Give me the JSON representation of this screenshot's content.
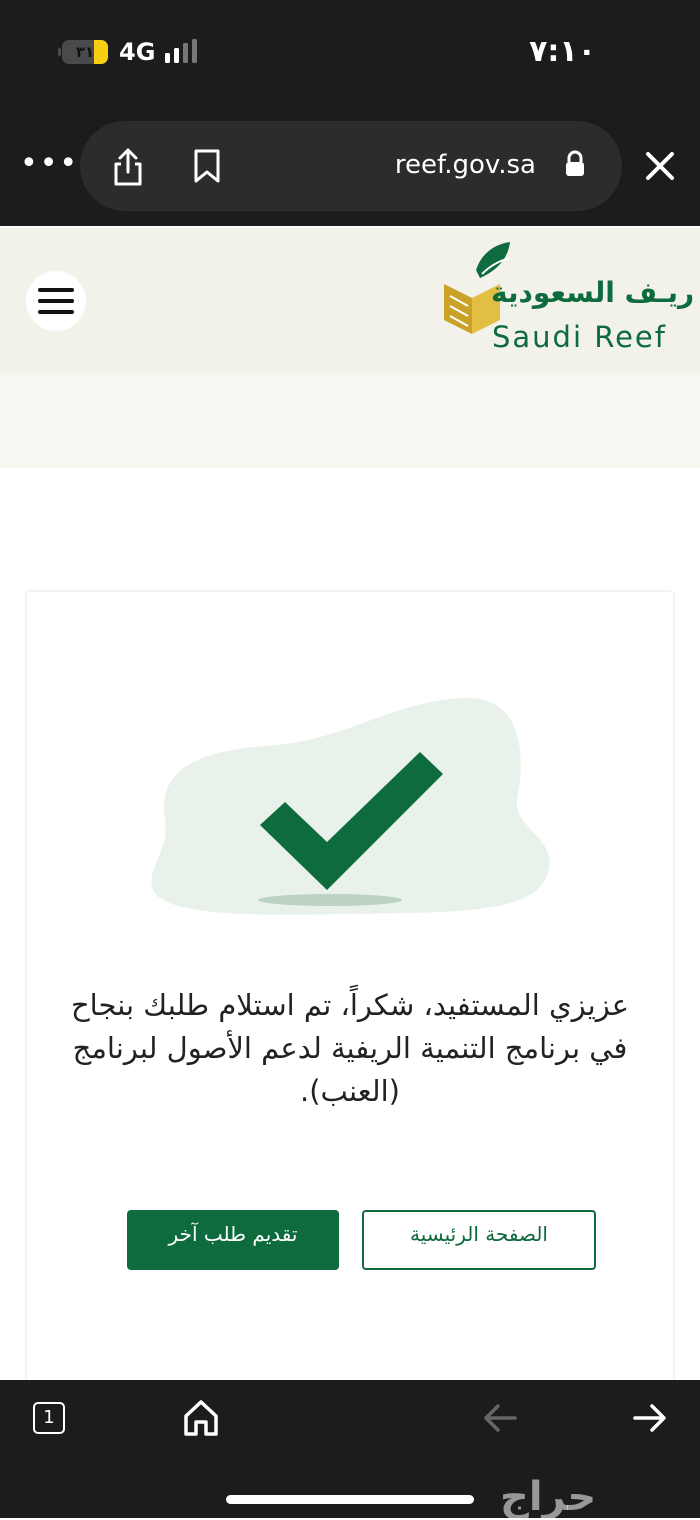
{
  "status_bar": {
    "time": "٧:١٠",
    "battery": "٣١",
    "battery_level_percent": 31,
    "network": "4G",
    "battery_color": "#f7cf10"
  },
  "browser": {
    "url": "reef.gov.sa",
    "more_label": "•••",
    "icons": [
      "more-icon",
      "share-icon",
      "bookmark-icon",
      "lock-icon",
      "close-icon"
    ]
  },
  "site": {
    "logo_arabic": "ريـف السعودية",
    "logo_english": "Saudi Reef",
    "brand_color": "#0e6b3d",
    "gold_color": "#c9a227"
  },
  "card": {
    "message": "عزيزي المستفيد، شكراً، تم استلام طلبك بنجاح في برنامج التنمية الريفية لدعم الأصول لبرنامج (العنب).",
    "submit_another_label": "تقديم طلب آخر",
    "home_label": "الصفحة الرئيسية"
  },
  "toolbar": {
    "tab_count": "1",
    "watermark": "حراج"
  }
}
